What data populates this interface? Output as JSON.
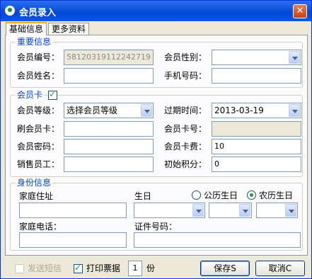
{
  "window": {
    "title": "会员录入",
    "close_label": "✕"
  },
  "tabs": [
    {
      "label": "基础信息",
      "active": true
    },
    {
      "label": "更多资料",
      "active": false
    }
  ],
  "important_info": {
    "legend": "重要信息",
    "member_no_label": "会员编号：",
    "member_no_value": "5812031911224271​9",
    "gender_label": "会员性别：",
    "gender_value": "",
    "name_label": "会员姓名：",
    "name_value": "",
    "phone_label": "手机号码：",
    "phone_value": ""
  },
  "member_card": {
    "legend": "会员卡",
    "enabled": true,
    "level_label": "会员等级：",
    "level_value": "选择会员等级",
    "expiry_label": "过期时间：",
    "expiry_value": "2013-03-19",
    "swipe_label": "刷会员卡：",
    "swipe_value": "",
    "card_no_label": "会员卡号：",
    "card_no_value": "",
    "password_label": "会员密码：",
    "password_value": "",
    "card_fee_label": "会员卡费：",
    "card_fee_value": "10",
    "sales_label": "销售员工：",
    "sales_value": "",
    "points_label": "初始积分：",
    "points_value": "0"
  },
  "identity": {
    "legend": "身份信息",
    "address_label": "家庭住址",
    "address_value": "",
    "birthday_label": "生日",
    "solar_label": "公历生日",
    "lunar_label": "农历生日",
    "birthday_mode": "lunar",
    "home_phone_label": "家庭电话：",
    "home_phone_value": "",
    "id_no_label": "证件号码：",
    "id_no_value": ""
  },
  "footer": {
    "sms_label": "发送短信",
    "sms_checked": false,
    "print_label": "打印票据",
    "print_checked": true,
    "copies_value": "1",
    "copies_unit": "份",
    "save_label": "保存S",
    "cancel_label": "取消C"
  }
}
